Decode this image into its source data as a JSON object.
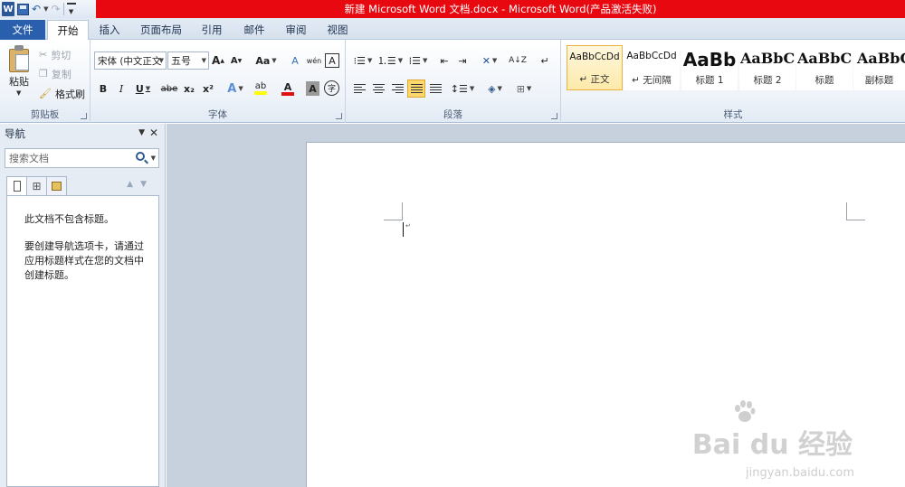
{
  "window": {
    "title": "新建 Microsoft Word 文档.docx  -  Microsoft Word(产品激活失败)",
    "app_logo": "W"
  },
  "tabs": {
    "file": "文件",
    "items": [
      "开始",
      "插入",
      "页面布局",
      "引用",
      "邮件",
      "审阅",
      "视图"
    ]
  },
  "ribbon": {
    "clipboard": {
      "label": "剪贴板",
      "paste": "粘贴",
      "cut": "剪切",
      "copy": "复制",
      "format_painter": "格式刷"
    },
    "font": {
      "label": "字体",
      "font_name": "宋体 (中文正文",
      "font_size": "五号",
      "grow": "A",
      "shrink": "A",
      "change_case": "Aa",
      "clear_format": "A",
      "phonetic": "wén",
      "border_char": "A",
      "bold": "B",
      "italic": "I",
      "underline": "U",
      "strike": "abe",
      "subscript": "x₂",
      "superscript": "x²",
      "text_effect": "A",
      "highlight": "ab",
      "font_color": "A",
      "char_shading": "A",
      "enclose": "字"
    },
    "paragraph": {
      "label": "段落"
    },
    "styles": {
      "label": "样式",
      "items": [
        {
          "sample": "AaBbCcDd",
          "name": "↵ 正文"
        },
        {
          "sample": "AaBbCcDd",
          "name": "↵ 无间隔"
        },
        {
          "sample": "AaBb",
          "name": "标题 1"
        },
        {
          "sample": "AaBbC",
          "name": "标题 2"
        },
        {
          "sample": "AaBbC",
          "name": "标题"
        },
        {
          "sample": "AaBbC",
          "name": "副标题"
        }
      ]
    }
  },
  "nav": {
    "title": "导航",
    "search_placeholder": "搜索文档",
    "message1": "此文档不包含标题。",
    "message2": "要创建导航选项卡，请通过应用标题样式在您的文档中创建标题。"
  },
  "watermark": {
    "main": "Bai du 经验",
    "sub": "jingyan.baidu.com"
  },
  "colors": {
    "title_bar": "#e8080f",
    "file_tab": "#2a5fae",
    "doc_background": "#c7d0dd",
    "font_color_bar": "#e01010",
    "highlight_bar": "#ffff00"
  }
}
